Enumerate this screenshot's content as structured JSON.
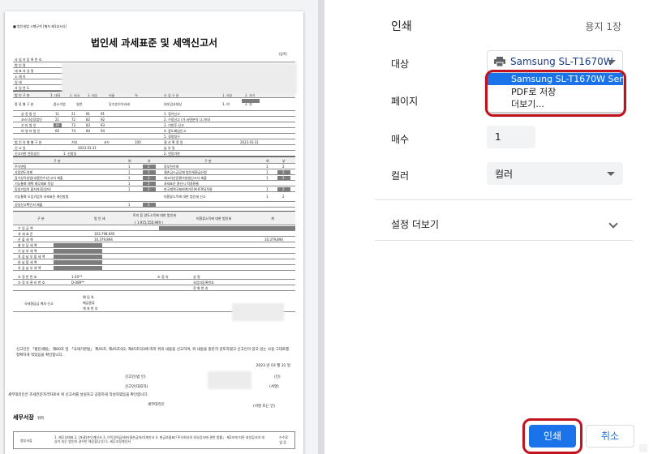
{
  "document": {
    "header_note": "■ 법인세법 시행규칙 [별지 제1호서식]",
    "title": "법인세 과세표준 및 세액신고서",
    "side_note": "(앞쪽)",
    "rows": [
      {
        "label": "사 업 자 등 록 번 호",
        "value": ""
      },
      {
        "label": "법 인 명",
        "value": ""
      },
      {
        "label": "대 표 자 성 명",
        "value": ""
      },
      {
        "label": "소 재 지",
        "value": ""
      },
      {
        "label": "업 태",
        "value": ""
      },
      {
        "label": "사 업 연 도",
        "value": ""
      }
    ],
    "section_1": [
      "법 인 구 분",
      "1. 내국",
      "2. 외국",
      "3. 외투",
      "비율",
      "%",
      "조 정 구 분",
      "1. 외부",
      "2. 자기"
    ],
    "kind_label": "종 류 별 구 분",
    "kind_cells": [
      "중소기업",
      "일반",
      "당기순이익과세",
      "외부감사대상",
      "1. 여",
      "2. 부"
    ],
    "kind_rows": [
      [
        "상 장 법 인",
        "11",
        "21",
        "81",
        "91"
      ],
      [
        "코스닥상장법인",
        "21",
        "72",
        "82",
        "92"
      ],
      [
        "기 타 법 인",
        "30",
        "73",
        "83",
        "93"
      ],
      [
        "비 영 리 법 인",
        "60",
        "74",
        "84",
        "94"
      ]
    ],
    "filing_options": [
      "1. 정기신고",
      "2. 수정신고 (가.서면분석 나.기타)",
      "3. 기한후 신고",
      "4. 중도폐업신고",
      "5. 경정청구"
    ],
    "misc_rows": [
      {
        "label": "법 인 유 형 별 구 분",
        "a": "기타",
        "b": "코드",
        "c": "100",
        "d": "결 산 확 정 일",
        "e": "2023.03.31"
      },
      {
        "label": "신 고 일",
        "a": "2023.03.31",
        "b": "",
        "c": "",
        "d": "납 부 일",
        "e": ""
      },
      {
        "label": "신고기한 연장승인",
        "a": "1. 신청일",
        "b": "",
        "c": "",
        "d": "2. 연장기한",
        "e": ""
      }
    ],
    "yn_header": [
      "구 분",
      "여",
      "부",
      "구 분",
      "여",
      "부"
    ],
    "yn_rows": [
      [
        "주식변동",
        "1",
        "2",
        "장부전산화",
        "1",
        "2"
      ],
      [
        "사업연도의제",
        "1",
        "2",
        "결손금소급공제 법인세환급신청",
        "1",
        "2"
      ],
      [
        "감가상각방법(내용연수)신고서 제출",
        "1",
        "2",
        "재고자산등평가방법신고서 제출",
        "1",
        "2"
      ],
      [
        "기능통화 채택 재무제표 작성",
        "1",
        "2",
        "과세표준 환산시 적용환율",
        "1",
        "2"
      ],
      [
        "동업기업의 출자자(동업자)",
        "1",
        "2",
        "한국채택국제회계기준(K-IFRS)적용",
        "1",
        "2"
      ],
      [
        "기능통화 도입기업의 과세표준 계산방법",
        "",
        "",
        "미환류소득에 대한 법인세 신고",
        "1",
        "2"
      ],
      [
        "성실신고확인서 제출",
        "1",
        "2",
        "",
        "",
        ""
      ]
    ],
    "tax_header": [
      "구 분",
      "법 인 세",
      "토지 등 양도소득에 대한 법인세",
      "미환류소득에 대한 법인세",
      "계"
    ],
    "tax_sub": "( 1,915,550,949 )",
    "tax_rows": [
      {
        "label": "수 입 금 액",
        "v1": "",
        "v2": "",
        "v3": "",
        "v4": ""
      },
      {
        "label": "과 세 표 준",
        "v1": "103,798,945",
        "v2": "",
        "v3": "",
        "v4": ""
      },
      {
        "label": "산 출 세 액",
        "v1": "10,379,894",
        "v2": "",
        "v3": "",
        "v4": "10,379,894"
      },
      {
        "label": "총 부 담 세 액",
        "v1": "",
        "v2": "",
        "v3": "",
        "v4": ""
      },
      {
        "label": "기 납 부 세 액",
        "v1": "",
        "v2": "",
        "v3": "",
        "v4": ""
      },
      {
        "label": "차 감 납 부 할 세 액",
        "v1": "",
        "v2": "",
        "v3": "",
        "v4": ""
      },
      {
        "label": "분 납 할 세 액",
        "v1": "",
        "v2": "",
        "v3": "",
        "v4": ""
      },
      {
        "label": "차 감 납 부 세 액",
        "v1": "",
        "v2": "",
        "v3": "",
        "v4": ""
      }
    ],
    "agent_rows": [
      {
        "label": "조 정 반 번 호",
        "value": "1-20**",
        "right": "조 정 자",
        "right2": "성 명"
      },
      {
        "label": "조 정 자 관 리 번 호",
        "value": "D-089**",
        "right": "",
        "right2": "사업자등록번호"
      },
      {
        "label": "",
        "value": "",
        "right": "",
        "right2": "전 화 번 호"
      }
    ],
    "refund_label": "국세환급금 계좌 신고",
    "refund_fields": [
      "예 입 처",
      "예금종류",
      "계 좌 번 호"
    ],
    "declaration": "신고인은 「법인세법」 제60조 및 「국세기본법」 제45조, 제45조의2, 제45조의3에 따라 위의 내용을 신고하며, 위 내용을 충분히 검토하였고 신고인이 알고 있는 사실 그대로를 정확하게 적었음을 확인합니다.",
    "decl_date": "2023 년 03 월 31 일",
    "signer1": "신고인(법 인)",
    "signer1_sign": "(인)",
    "signer2": "신고인(대표자)",
    "signer2_sign": "(서명)",
    "tax_agent_statement": "세무대리인은 조세전문자격자로서 위 신고서를 성실하고 공정하게 작성하였음을 확인합니다.",
    "tax_agent": "세무대리인",
    "tax_agent_sign": "(서명 또는 인)",
    "recipient": "세무서장",
    "recipient_suffix": "귀하",
    "footer_label": "첨부서류",
    "footer_text": "1. 재무상태표 2. (포괄)손익계산서 3. 이익잉여금처분(결손금처리)계산서 4. 현금흐름표(「주식회사의 외부감사에 관한 법률」 제2조에 따른 외부감사의 대상이 되는 법인의 경우만 해당합니다) 5. 세무조정계산서",
    "footer_fee_label": "수수료",
    "footer_fee": "없 음"
  },
  "panel": {
    "title": "인쇄",
    "sheets": "용지 1장",
    "destination": {
      "label": "대상",
      "value": "Samsung SL-T1670W",
      "options": [
        "Samsung SL-T1670W Series",
        "PDF로 저장",
        "더보기..."
      ]
    },
    "pages": {
      "label": "페이지"
    },
    "copies": {
      "label": "매수",
      "value": "1"
    },
    "color": {
      "label": "컬러",
      "value": "컬러"
    },
    "more_settings": {
      "label": "설정 더보기"
    },
    "print_label": "인쇄",
    "cancel_label": "취소"
  },
  "colors": {
    "accent": "#1a73e8",
    "highlight_ring": "#c0121f",
    "panel_bg": "#ffffff",
    "preview_bg": "#f1f3f4"
  },
  "icons": [
    "printer-icon",
    "chevron-down-icon"
  ]
}
